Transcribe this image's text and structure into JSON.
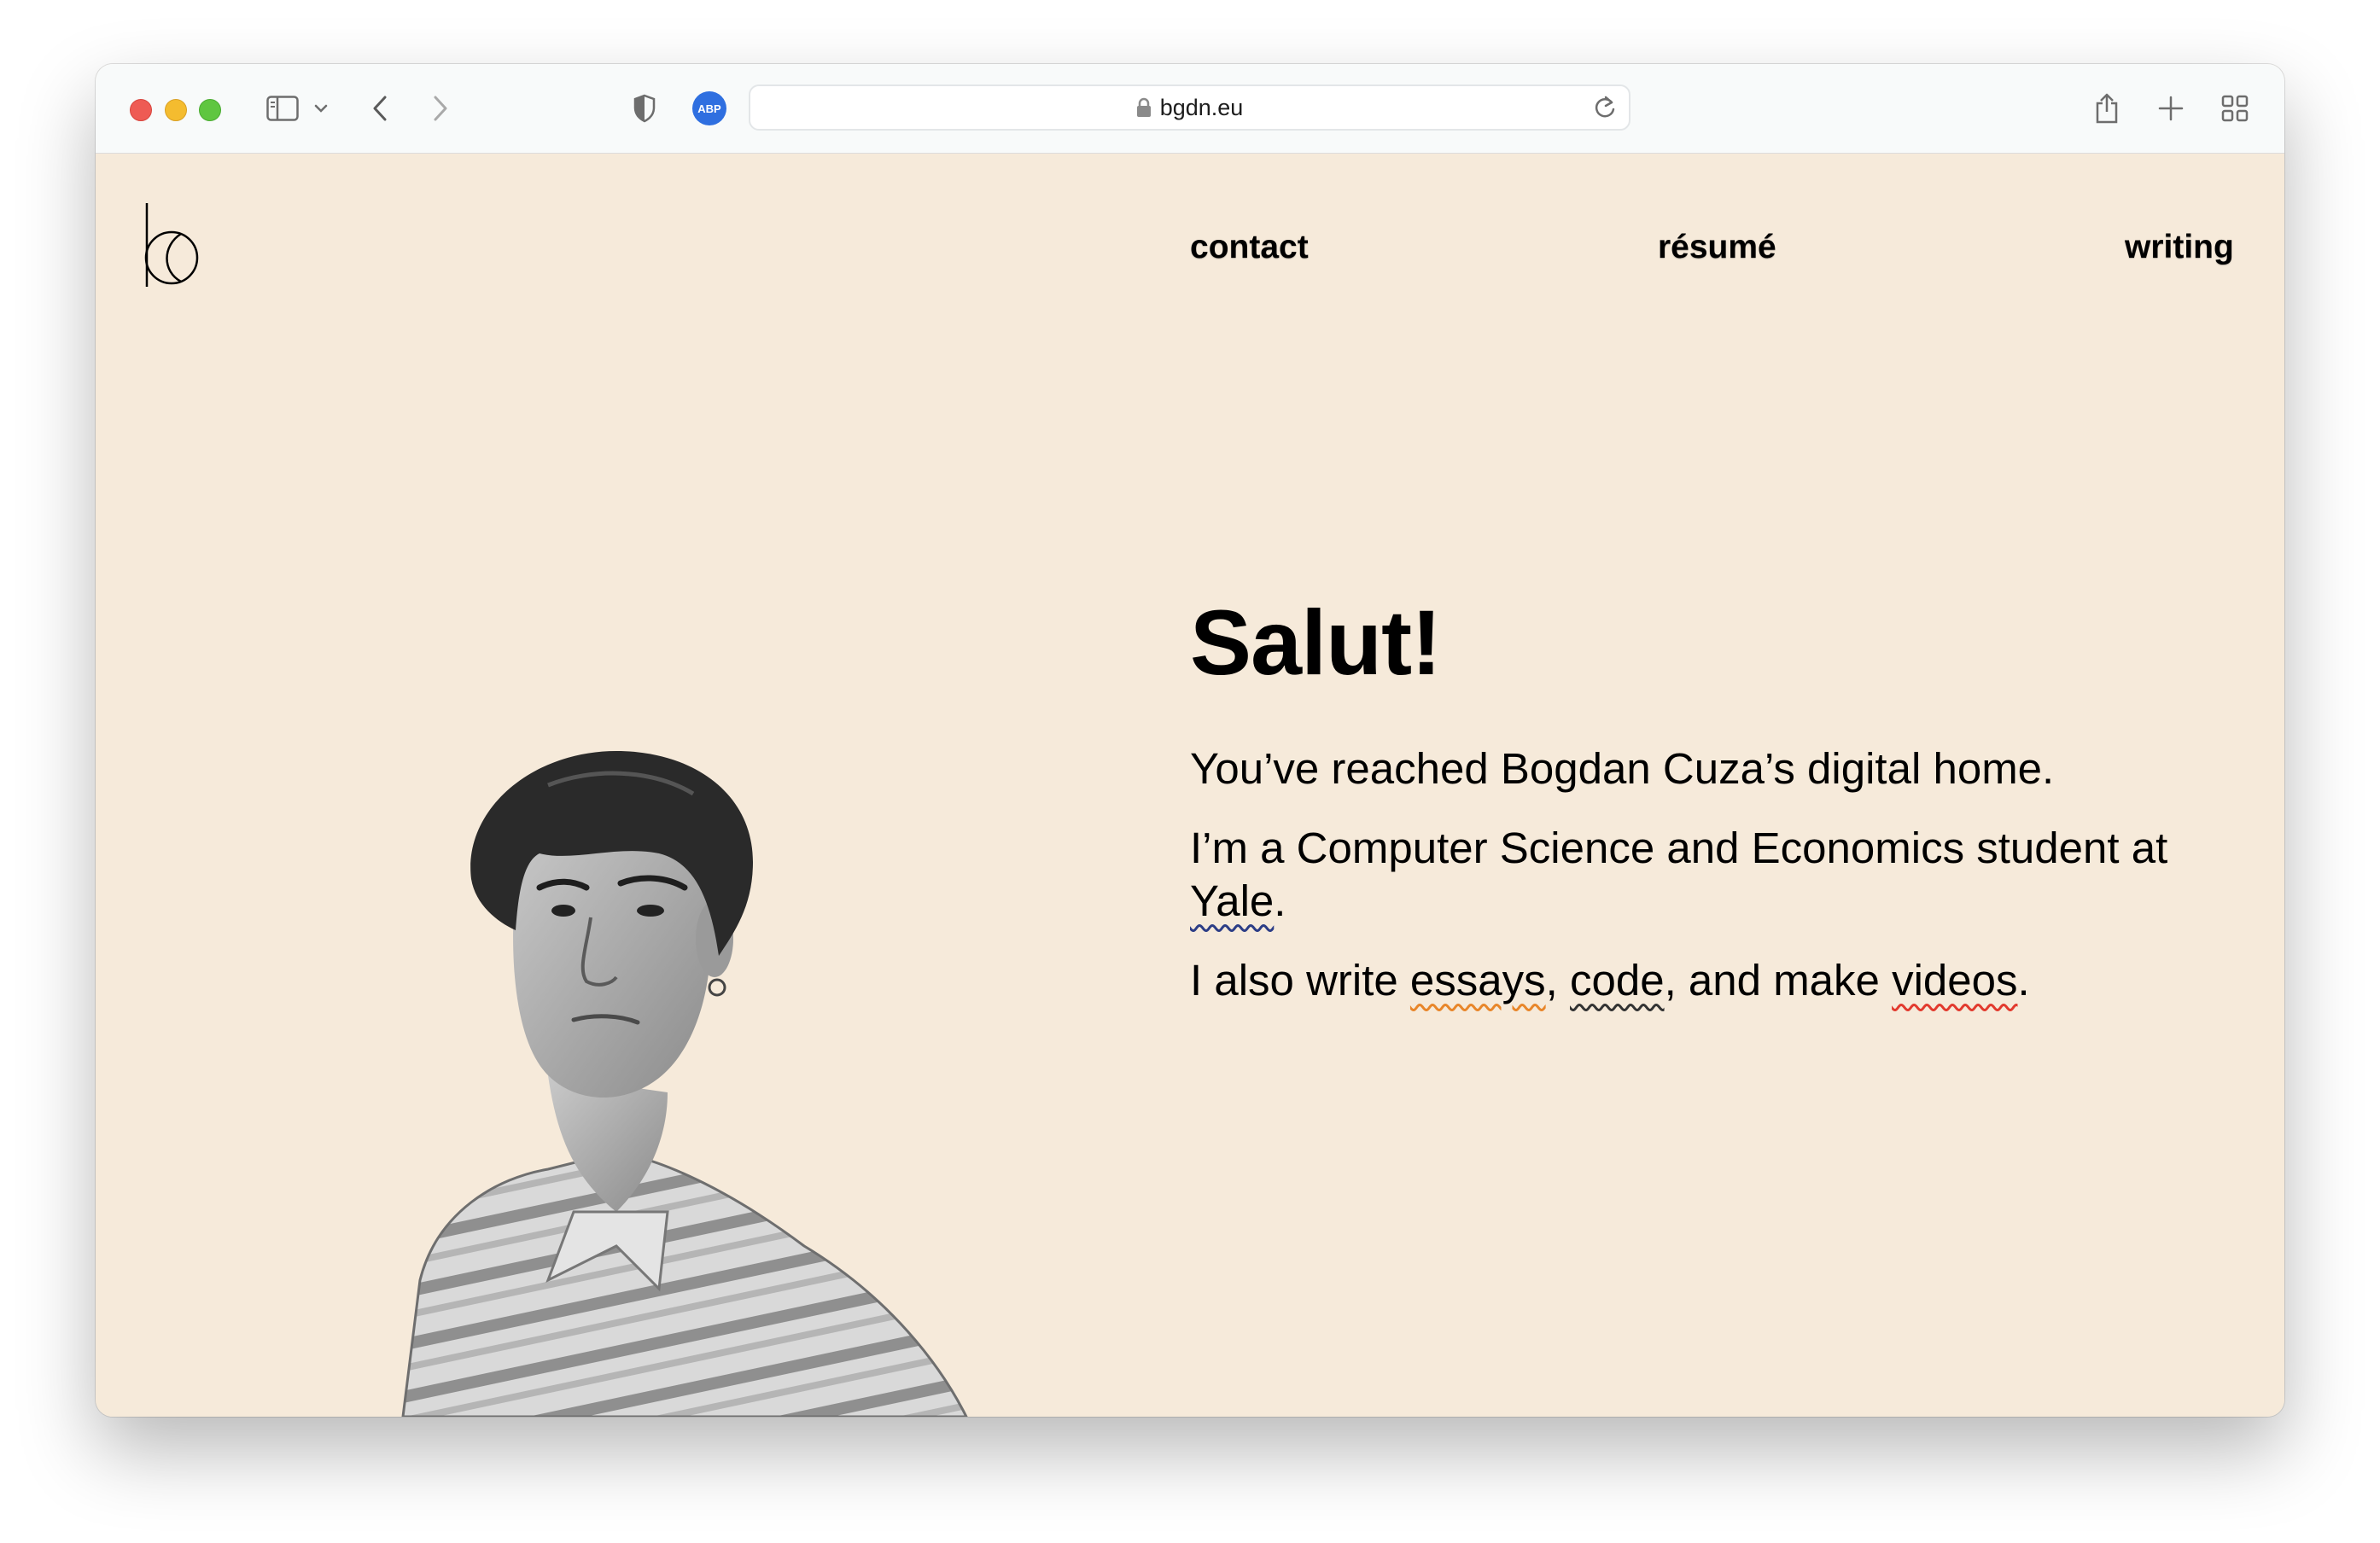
{
  "browser": {
    "url": "bgdn.eu",
    "extension_badge": "ABP"
  },
  "site": {
    "logo_alt": "b"
  },
  "nav": {
    "contact": "contact",
    "resume": "résumé",
    "writing": "writing"
  },
  "hero": {
    "title": "Salut!",
    "line1": "You’ve reached Bogdan Cuza’s digital home.",
    "line2_pre": "I’m a Computer Science and Economics student at ",
    "line2_link": "Yale",
    "line2_post": ".",
    "line3_pre": "I also write ",
    "line3_link1": "essays",
    "line3_sep1": ", ",
    "line3_link2": "code",
    "line3_sep2": ", and make ",
    "line3_link3": "videos",
    "line3_post": "."
  },
  "colors": {
    "page_bg": "#f6eada",
    "text": "#000000",
    "accent_abp": "#2f6fe0"
  }
}
